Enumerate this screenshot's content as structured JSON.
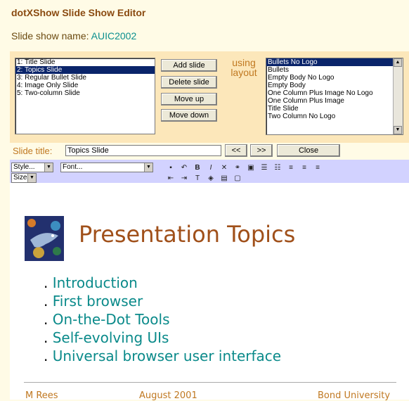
{
  "app": {
    "title": "dotXShow Slide Show Editor",
    "show_name_label": "Slide show name:",
    "show_name": "AUIC2002"
  },
  "slides": {
    "items": [
      "1: Title Slide",
      "2: Topics Slide",
      "3: Regular Bullet Slide",
      "4: Image Only Slide",
      "5: Two-column Slide"
    ],
    "selected_index": 1
  },
  "buttons": {
    "add_slide": "Add slide",
    "delete_slide": "Delete slide",
    "move_up": "Move up",
    "move_down": "Move down",
    "prev": "<<",
    "next": ">>",
    "close": "Close"
  },
  "layout": {
    "using_label": "using layout",
    "items": [
      "Bullets No Logo",
      "Bullets",
      "Empty Body No Logo",
      "Empty Body",
      "One Column Plus Image No Logo",
      "One Column Plus Image",
      "Title Slide",
      "Two Column No Logo"
    ],
    "selected_index": 0
  },
  "slide_title": {
    "label": "Slide title:",
    "value": "Topics Slide"
  },
  "toolbar": {
    "style_select": "Style...",
    "font_select": "Font...",
    "size_select": "Size...",
    "icons_row1": [
      {
        "name": "save-icon",
        "glyph": "▪"
      },
      {
        "name": "undo-icon",
        "glyph": "↶"
      },
      {
        "name": "bold-icon",
        "glyph": "B"
      },
      {
        "name": "italic-icon",
        "glyph": "I"
      },
      {
        "name": "cut-icon",
        "glyph": "✕"
      },
      {
        "name": "link-icon",
        "glyph": "⚭"
      },
      {
        "name": "image-icon",
        "glyph": "▣"
      },
      {
        "name": "bullet-list-icon",
        "glyph": "☰"
      },
      {
        "name": "numbered-list-icon",
        "glyph": "☷"
      },
      {
        "name": "align-left-icon",
        "glyph": "≡"
      },
      {
        "name": "align-center-icon",
        "glyph": "≡"
      },
      {
        "name": "align-right-icon",
        "glyph": "≡"
      }
    ],
    "icons_row2": [
      {
        "name": "outdent-icon",
        "glyph": "⇤"
      },
      {
        "name": "indent-icon",
        "glyph": "⇥"
      },
      {
        "name": "font-color-icon",
        "glyph": "T"
      },
      {
        "name": "fill-color-icon",
        "glyph": "◈"
      },
      {
        "name": "table-icon",
        "glyph": "▤"
      },
      {
        "name": "insert-box-icon",
        "glyph": "▢"
      }
    ]
  },
  "slide_content": {
    "heading": "Presentation Topics",
    "bullets": [
      "Introduction",
      "First browser",
      "On-the-Dot Tools",
      "Self-evolving UIs",
      "Universal browser user interface"
    ],
    "footer_left": "M Rees",
    "footer_center": "August 2001",
    "footer_right": "Bond University"
  },
  "colors": {
    "app_background": "#fffbe6",
    "panel_background": "#fce7ba",
    "toolbar_background": "#d2d2ff",
    "heading_color": "#a0501a",
    "bullet_color": "#0a8a8a",
    "selection": "#0a246a"
  }
}
